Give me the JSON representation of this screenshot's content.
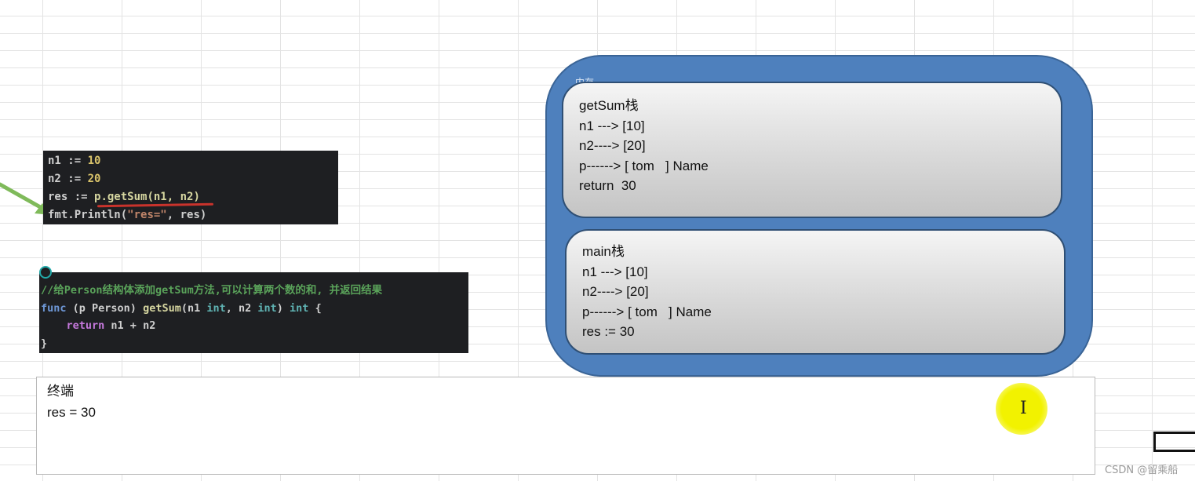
{
  "code_snippet_call": {
    "lines": [
      {
        "a": "n1 := ",
        "b": "10"
      },
      {
        "a": "n2 := ",
        "b": "20"
      },
      {
        "a": "res := ",
        "b": "p.getSum(n1, n2)"
      },
      {
        "a": "fmt.Println(",
        "b": "\"res=\"",
        "c": ", res)"
      }
    ]
  },
  "code_snippet_method": {
    "comment": "//给Person结构体添加getSum方法,可以计算两个数的和, 并返回结果",
    "line2": {
      "kw": "func",
      "a": " (p Person) ",
      "fn": "getSum",
      "b": "(n1 ",
      "t1": "int",
      "c": ", n2 ",
      "t2": "int",
      "d": ") ",
      "t3": "int",
      "e": " {"
    },
    "line3": {
      "kw": "return",
      "a": " n1 + n2"
    },
    "line4": "}"
  },
  "outer_label": "内存",
  "stack_frames": [
    {
      "title": "getSum栈",
      "lines": [
        "n1 ---> [10]",
        "n2----> [20]",
        "p------> [ tom   ] Name",
        "return  30"
      ]
    },
    {
      "title": "main栈",
      "lines": [
        "n1 ---> [10]",
        "n2----> [20]",
        "p------> [ tom   ] Name",
        "res := 30"
      ]
    }
  ],
  "terminal": {
    "title": "终端",
    "output": "res = 30"
  },
  "cursor_glyph": "I",
  "watermark": "CSDN @留乘船",
  "colors": {
    "memory_bg": "#4e80bd",
    "code_bg": "#1e1f22",
    "arrow": "#7fba5a",
    "highlight": "#f2f200"
  }
}
